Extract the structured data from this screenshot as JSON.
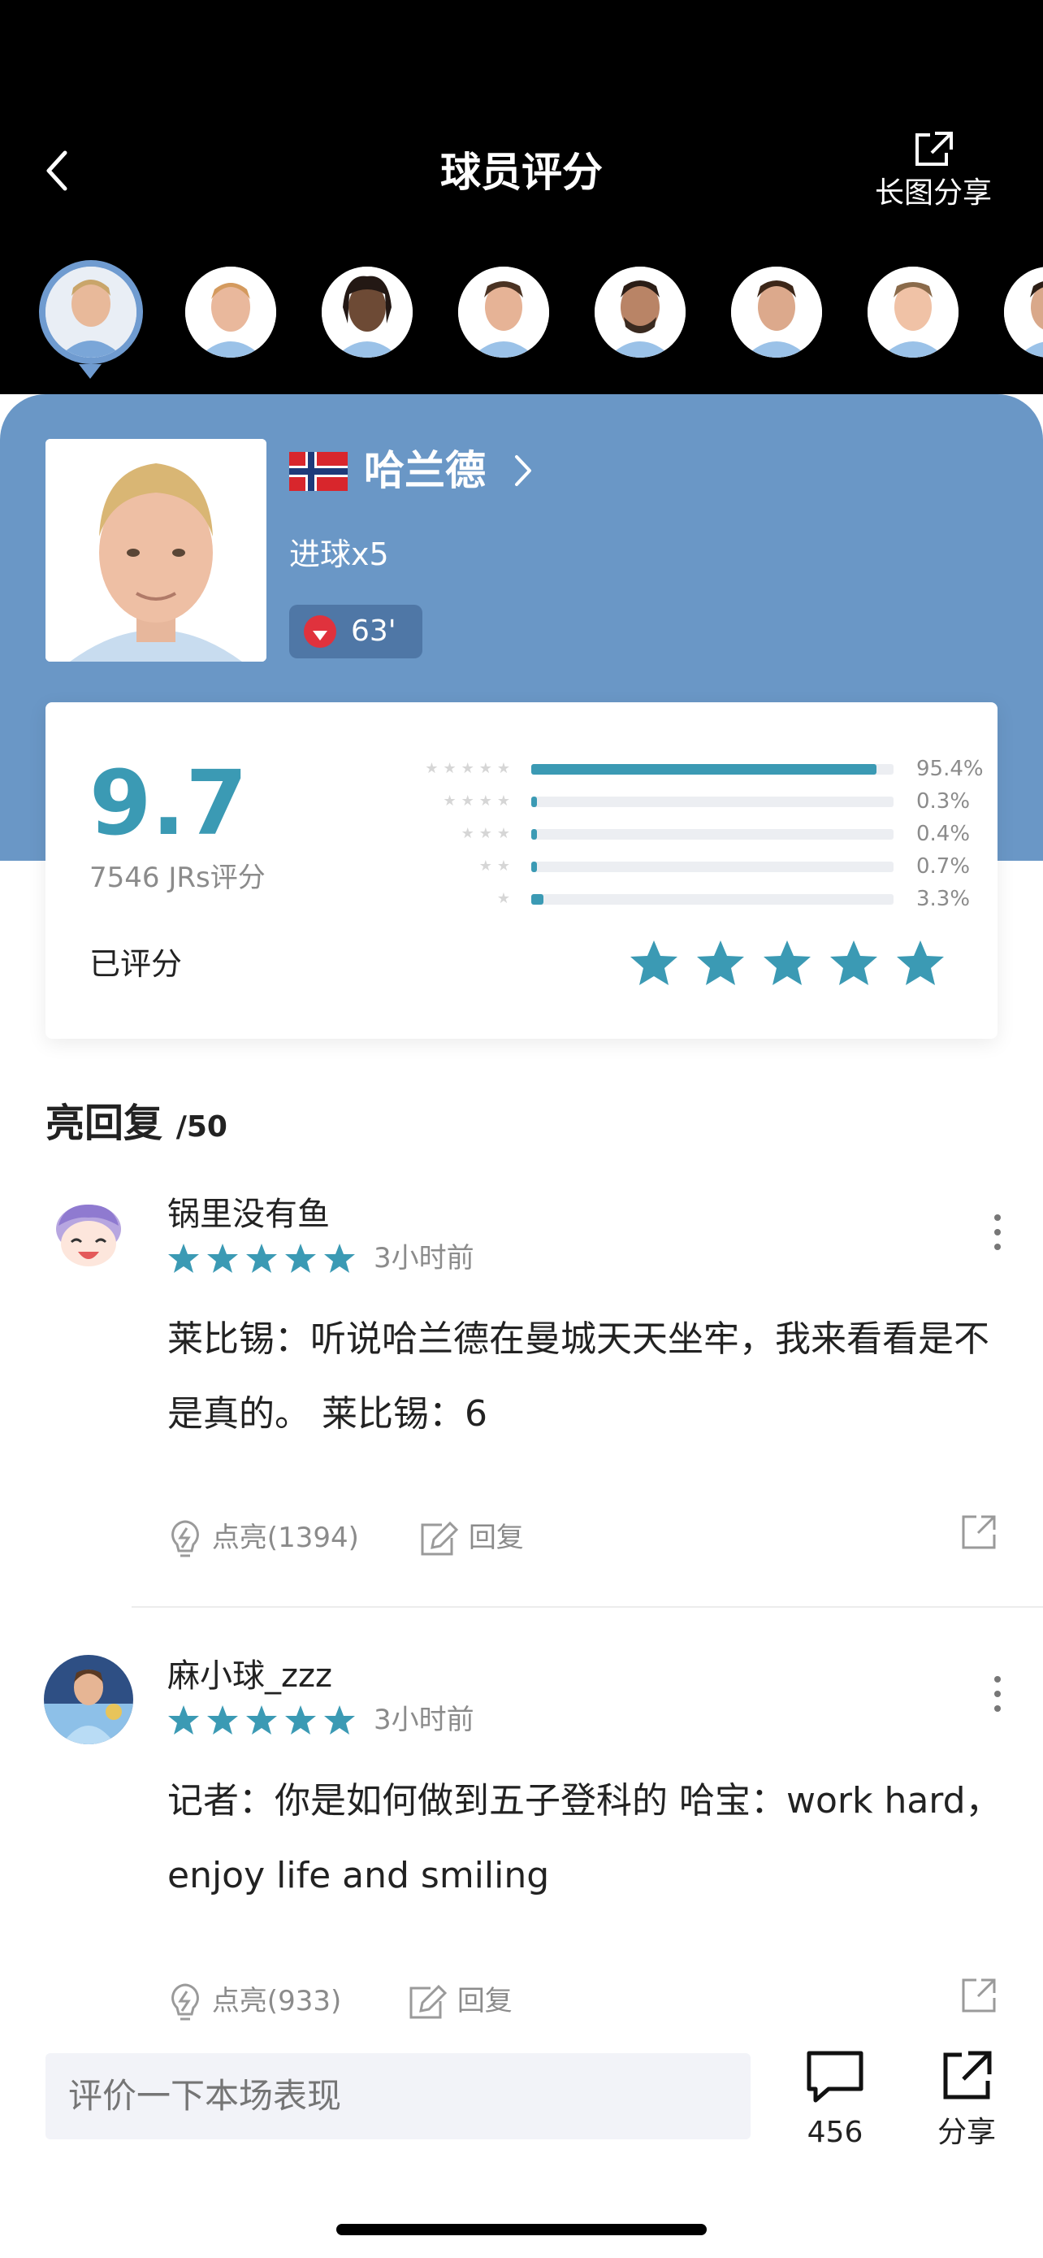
{
  "header": {
    "title": "球员评分",
    "share_label": "长图分享",
    "back_icon": "chevron-left-icon",
    "share_icon": "external-share-icon"
  },
  "player_strip": {
    "count": 8,
    "selected_index": 0
  },
  "player": {
    "flag": "norway-flag",
    "name": "哈兰德",
    "stat": "进球x5",
    "sub_minute": "63'"
  },
  "rating": {
    "score": "9.7",
    "votes": "7546 JRs评分",
    "distribution": [
      {
        "stars": 5,
        "percent": 95.4,
        "label": "95.4%"
      },
      {
        "stars": 4,
        "percent": 0.3,
        "label": "0.3%"
      },
      {
        "stars": 3,
        "percent": 0.4,
        "label": "0.4%"
      },
      {
        "stars": 2,
        "percent": 0.7,
        "label": "0.7%"
      },
      {
        "stars": 1,
        "percent": 3.3,
        "label": "3.3%"
      }
    ],
    "rated_label": "已评分",
    "my_stars": 5,
    "accent": "#3b9ab4"
  },
  "replies": {
    "title": "亮回复",
    "count": "/50",
    "items": [
      {
        "user": "锅里没有鱼",
        "stars": 5,
        "time": "3小时前",
        "text": "莱比锡：听说哈兰德在曼城天天坐牢，我来看看是不是真的。 莱比锡：6",
        "like": "点亮(1394)",
        "reply": "回复"
      },
      {
        "user": "麻小球_zzz",
        "stars": 5,
        "time": "3小时前",
        "text": "记者：你是如何做到五子登科的 哈宝：work hard，enjoy life and smiling",
        "like": "点亮(933)",
        "reply": "回复"
      }
    ]
  },
  "bottom": {
    "placeholder": "评价一下本场表现",
    "comment_count": "456",
    "share_label": "分享"
  }
}
